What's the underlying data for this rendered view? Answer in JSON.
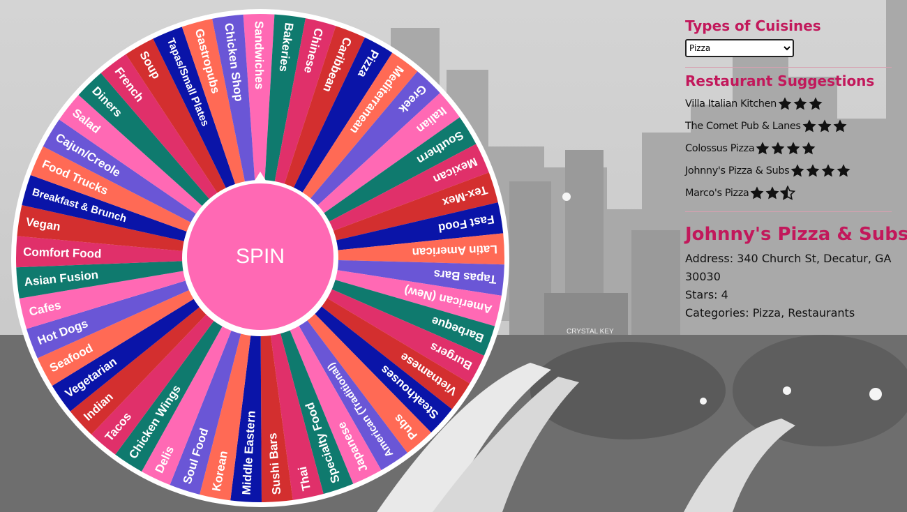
{
  "wheel": {
    "segments": [
      "Sandwiches",
      "Bakeries",
      "Chinese",
      "Caribbean",
      "Pizza",
      "Mediterranean",
      "Greek",
      "Italian",
      "Southern",
      "Mexican",
      "Tex-Mex",
      "Fast Food",
      "Latin American",
      "Tapas Bars",
      "American (New)",
      "Barbeque",
      "Burgers",
      "Vietnamese",
      "Steakhouses",
      "Pubs",
      "American (Traditional)",
      "Japanese",
      "Specialty Food",
      "Thai",
      "Sushi Bars",
      "Middle Eastern",
      "Korean",
      "Soul Food",
      "Delis",
      "Chicken Wings",
      "Tacos",
      "Indian",
      "Vegetarian",
      "Seafood",
      "Hot Dogs",
      "Cafes",
      "Asian Fusion",
      "Comfort Food",
      "Vegan",
      "Breakfast & Brunch",
      "Food Trucks",
      "Cajun/Creole",
      "Salad",
      "Diners",
      "French",
      "Soup",
      "Tapas/Small Plates",
      "Gastropubs",
      "Chicken Shop"
    ],
    "colors": [
      "#ff69b4",
      "#0f7a6e",
      "#e0306a",
      "#d32f2f",
      "#0a14a8",
      "#ff6a55",
      "#6a56d6"
    ],
    "spin_label": "SPIN",
    "rim_color": "#ffffff"
  },
  "panel": {
    "cuisine_heading": "Types of Cuisines",
    "cuisine_selected": "Pizza",
    "suggestions_heading": "Restaurant Suggestions",
    "suggestions": [
      {
        "name": "Villa Italian Kitchen",
        "stars": 3
      },
      {
        "name": "The Comet Pub & Lanes",
        "stars": 3
      },
      {
        "name": "Colossus Pizza",
        "stars": 4
      },
      {
        "name": "Johnny's Pizza & Subs",
        "stars": 4
      },
      {
        "name": "Marco's Pizza",
        "stars": 2.5
      }
    ],
    "detail": {
      "name": "Johnny's Pizza & Subs",
      "address": "Address: 340 Church St, Decatur, GA 30030",
      "stars": "Stars: 4",
      "categories": "Categories: Pizza, Restaurants"
    },
    "accent_color": "#c2185b"
  },
  "background": {
    "sign_text": "CRYSTAL KEY"
  }
}
